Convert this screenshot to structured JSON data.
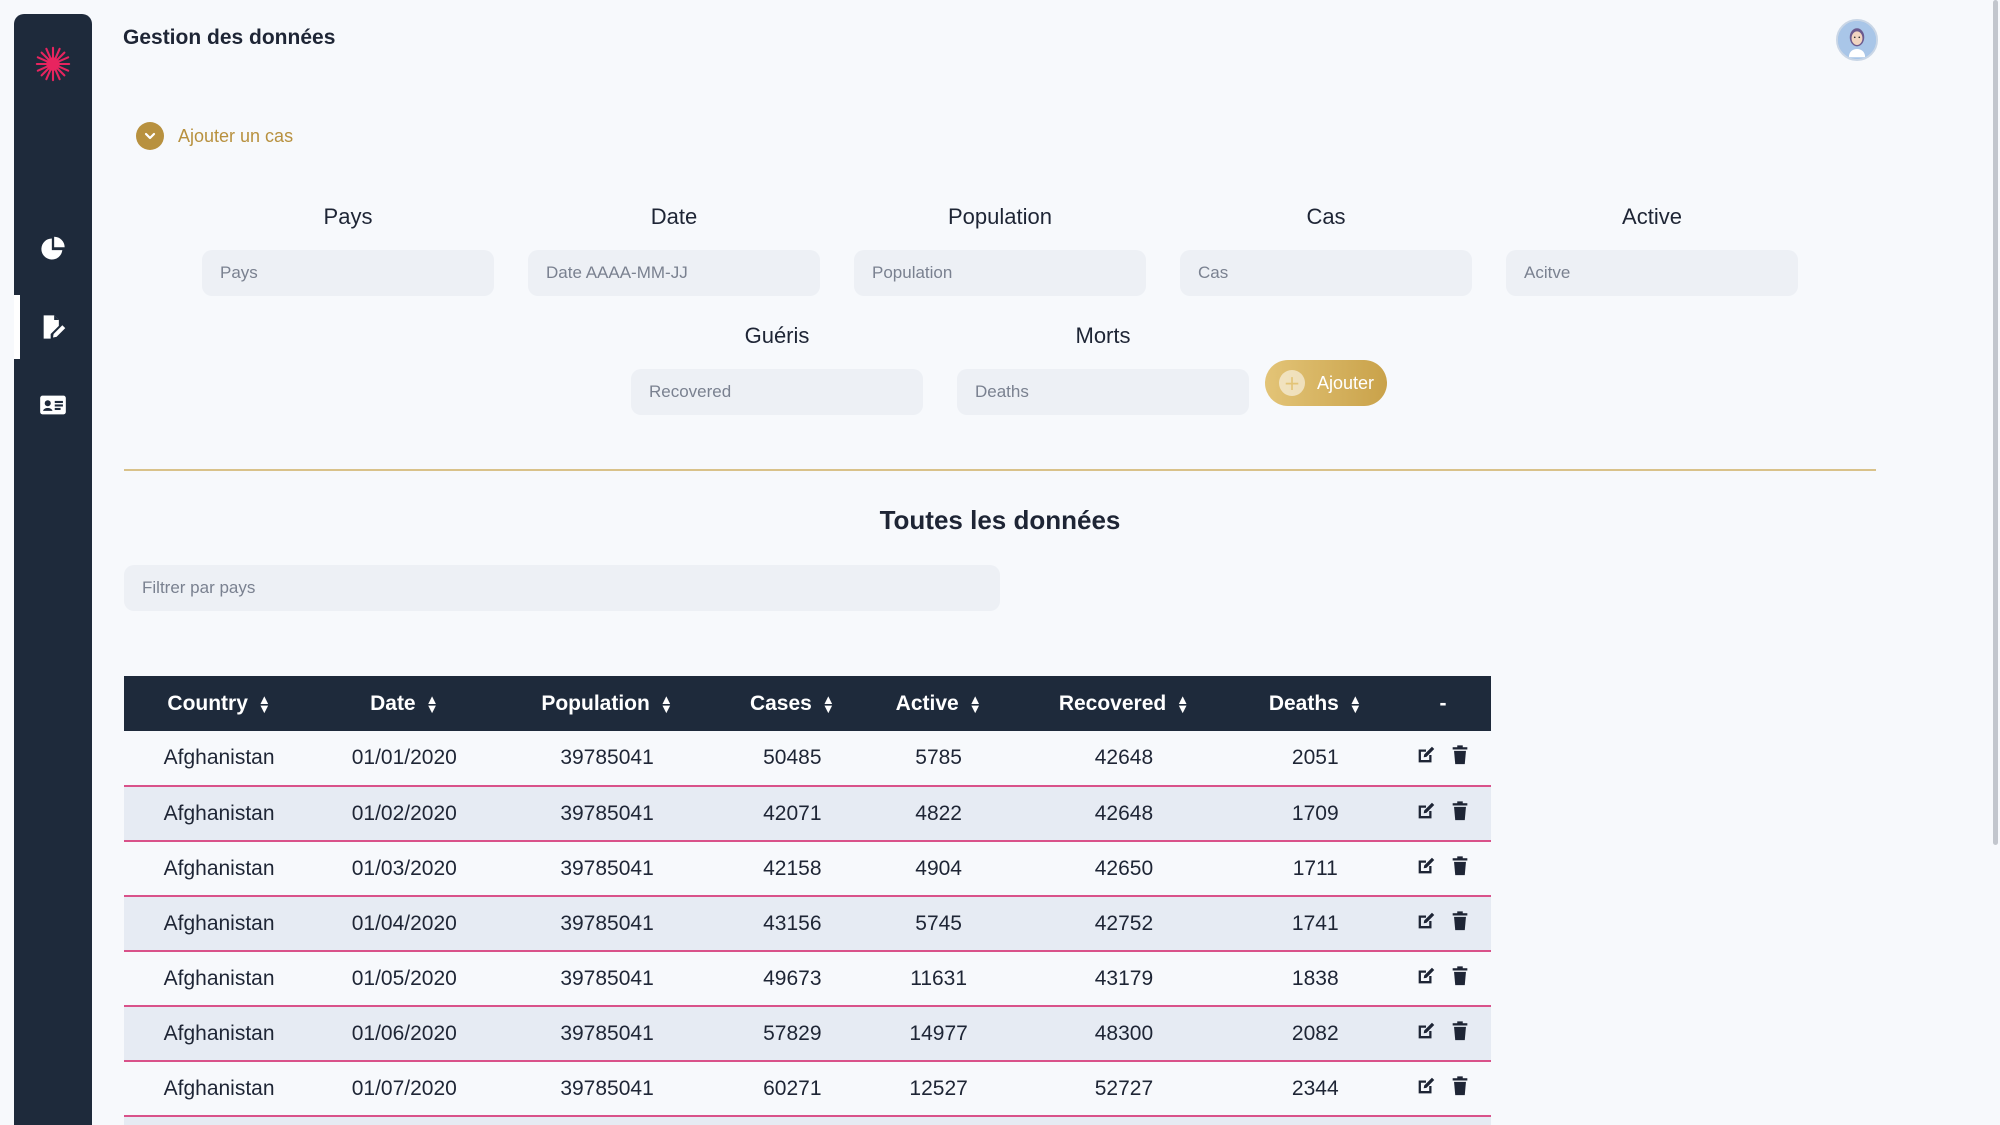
{
  "app": {
    "page_title": "Gestion des données",
    "accent": "#b8913f",
    "sidebar_color": "#1e2a3b",
    "row_border": "#d9528a"
  },
  "sidebar": {
    "items": [
      {
        "name": "chart-pie-icon",
        "active": false
      },
      {
        "name": "file-edit-icon",
        "active": true
      },
      {
        "name": "id-card-icon",
        "active": false
      }
    ]
  },
  "form": {
    "toggle_label": "Ajouter un cas",
    "fields": {
      "pays": {
        "label": "Pays",
        "placeholder": "Pays"
      },
      "date": {
        "label": "Date",
        "placeholder": "Date AAAA-MM-JJ"
      },
      "population": {
        "label": "Population",
        "placeholder": "Population"
      },
      "cas": {
        "label": "Cas",
        "placeholder": "Cas"
      },
      "active": {
        "label": "Active",
        "placeholder": "Acitve"
      },
      "gueris": {
        "label": "Guéris",
        "placeholder": "Recovered"
      },
      "morts": {
        "label": "Morts",
        "placeholder": "Deaths"
      }
    },
    "submit_label": "Ajouter"
  },
  "data_section": {
    "title": "Toutes les données",
    "filter_placeholder": "Filtrer par pays"
  },
  "table": {
    "headers": [
      "Country",
      "Date",
      "Population",
      "Cases",
      "Active",
      "Recovered",
      "Deaths",
      "-"
    ],
    "rows": [
      [
        "Afghanistan",
        "01/01/2020",
        "39785041",
        "50485",
        "5785",
        "42648",
        "2051"
      ],
      [
        "Afghanistan",
        "01/02/2020",
        "39785041",
        "42071",
        "4822",
        "42648",
        "1709"
      ],
      [
        "Afghanistan",
        "01/03/2020",
        "39785041",
        "42158",
        "4904",
        "42650",
        "1711"
      ],
      [
        "Afghanistan",
        "01/04/2020",
        "39785041",
        "43156",
        "5745",
        "42752",
        "1741"
      ],
      [
        "Afghanistan",
        "01/05/2020",
        "39785041",
        "49673",
        "11631",
        "43179",
        "1838"
      ],
      [
        "Afghanistan",
        "01/06/2020",
        "39785041",
        "57829",
        "14977",
        "48300",
        "2082"
      ],
      [
        "Afghanistan",
        "01/07/2020",
        "39785041",
        "60271",
        "12527",
        "52727",
        "2344"
      ],
      [
        "",
        "",
        "",
        "",
        "",
        "",
        ""
      ]
    ]
  }
}
